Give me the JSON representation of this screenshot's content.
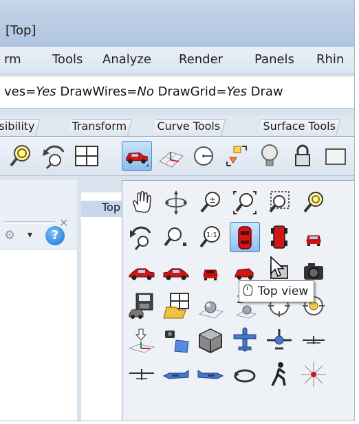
{
  "window": {
    "title": "[Top]"
  },
  "menubar": {
    "items": [
      "rm",
      "Tools",
      "Analyze",
      "Render",
      "Panels",
      "Rhin"
    ]
  },
  "command_line": {
    "segments": [
      {
        "text": "ves=",
        "italic": false
      },
      {
        "text": "Yes",
        "italic": true
      },
      {
        "text": " DrawWires=",
        "italic": false
      },
      {
        "text": "No",
        "italic": true
      },
      {
        "text": " DrawGrid=",
        "italic": false
      },
      {
        "text": "Yes",
        "italic": true
      },
      {
        "text": " Draw",
        "italic": false
      }
    ]
  },
  "tabs": [
    "sibility",
    "Transform",
    "Curve Tools",
    "Surface Tools"
  ],
  "toolbar": {
    "icons": [
      "zoom-extents-icon",
      "rotate-view-icon",
      "four-viewports-icon",
      "set-view-car-icon",
      "grid-options-icon",
      "cplane-icon",
      "named-position-icon",
      "light-bulb-icon",
      "lock-icon"
    ]
  },
  "left_panel": {
    "close_glyph": "×",
    "gear_glyph": "⚙",
    "dropdown_glyph": "▾",
    "help_label": "?"
  },
  "viewport": {
    "tab_label": "Top"
  },
  "flyout": {
    "rows": [
      [
        "pan-hand-icon",
        "rotate-icon",
        "zoom-icon",
        "zoom-extents-icon",
        "zoom-window-icon",
        "zoom-selected-icon"
      ],
      [
        "undo-view-icon",
        "zoom-target-icon",
        "zoom-1to1-icon",
        "top-view-car-icon",
        "bottom-view-car-icon",
        "front-view-car-icon"
      ],
      [
        "left-view-car-icon",
        "right-view-car-icon",
        "back-view-car-icon",
        "perspective-car-icon",
        "two-point-icon",
        "camera-icon"
      ],
      [
        "save-view-icon",
        "restore-view-icon",
        "plane-sphere-icon",
        "two-view-icon",
        "target-icon",
        "target-sphere-icon"
      ],
      [
        "set-cplane-icon",
        "camera-move-icon",
        "box-view-icon",
        "aircraft-top-icon",
        "aircraft-front-icon",
        "aircraft-side-icon"
      ],
      [
        "aircraft-low-icon",
        "aircraft-left-icon",
        "aircraft-right-icon",
        "orbit-icon",
        "walkabout-icon",
        "sun-icon"
      ]
    ]
  },
  "tooltip": {
    "label": "Top view"
  },
  "colors": {
    "accent": "#3b7fc4",
    "car_red": "#d21515",
    "title_bar": "#b8cce4"
  }
}
